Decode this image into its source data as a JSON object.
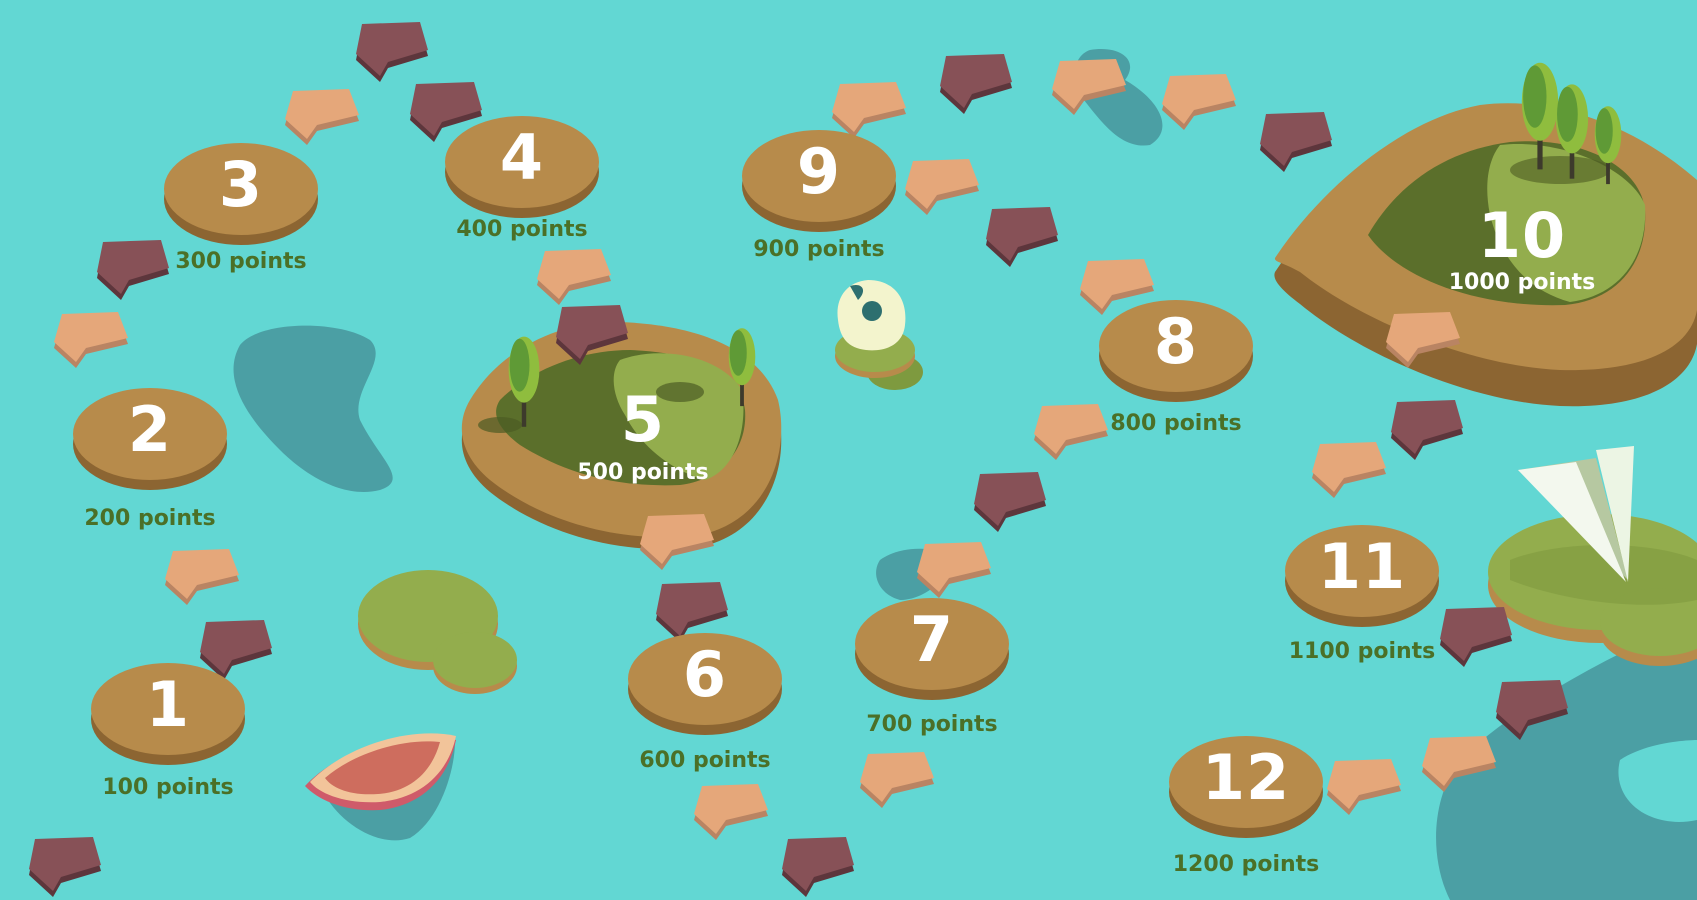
{
  "game": {
    "levels": [
      {
        "number": "1",
        "points": "100 points"
      },
      {
        "number": "2",
        "points": "200 points"
      },
      {
        "number": "3",
        "points": "300 points"
      },
      {
        "number": "4",
        "points": "400 points"
      },
      {
        "number": "5",
        "points": "500 points"
      },
      {
        "number": "6",
        "points": "600 points"
      },
      {
        "number": "7",
        "points": "700 points"
      },
      {
        "number": "8",
        "points": "800 points"
      },
      {
        "number": "9",
        "points": "900 points"
      },
      {
        "number": "10",
        "points": "1000 points"
      },
      {
        "number": "11",
        "points": "1100 points"
      },
      {
        "number": "12",
        "points": "1200 points"
      }
    ]
  },
  "colors": {
    "water": "#62d7d3",
    "deep_water": "#4b9fa4",
    "platform_top": "#b78b4b",
    "platform_side": "#8c6532",
    "points_text": "#4b7027",
    "arrow_light": "#e5a77a",
    "arrow_dark": "#875157",
    "grass_dark": "#5b6f2b",
    "grass_light": "#93ad4d"
  },
  "icons": [
    "tree-icon",
    "sail-icon",
    "boat-icon",
    "cave-rock-icon",
    "arrow-icon"
  ]
}
